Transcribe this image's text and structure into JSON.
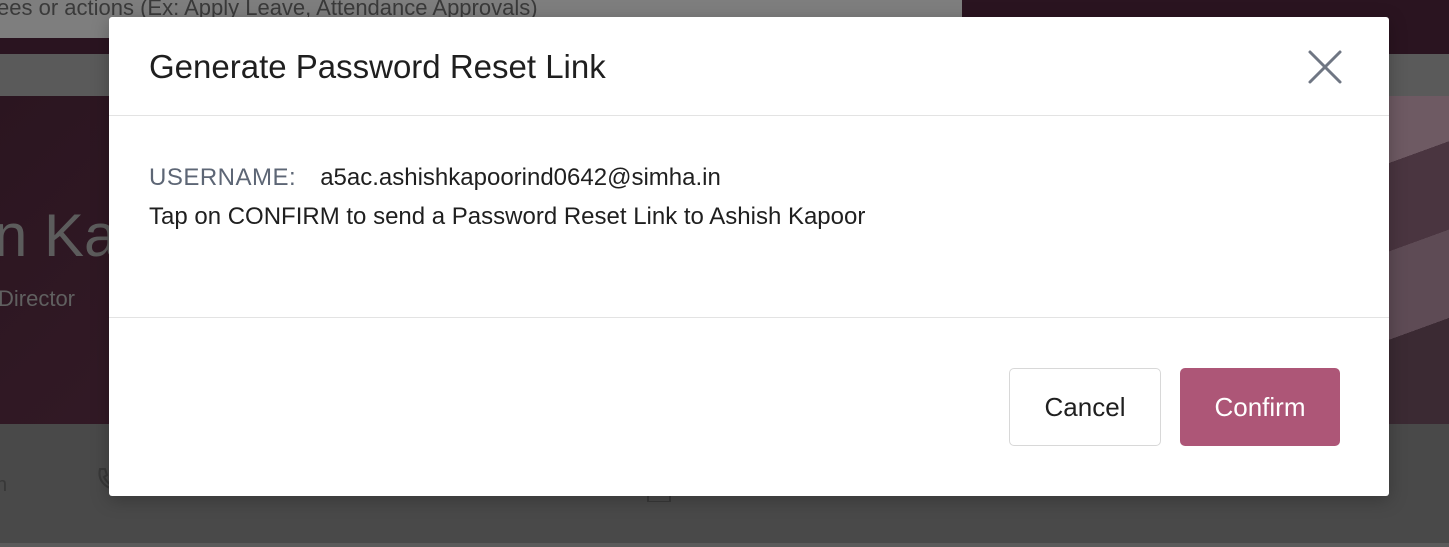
{
  "background": {
    "search_placeholder": "yees or actions (Ex: Apply Leave, Attendance Approvals)",
    "employee_name_fragment": "n Kap",
    "employee_role_fragment": "Director",
    "lower_fragment": "n"
  },
  "modal": {
    "title": "Generate Password Reset Link",
    "close_icon": "close-icon",
    "username_label": "USERNAME:",
    "username_value": "a5ac.ashishkapoorind0642@simha.in",
    "description": "Tap on CONFIRM to send a Password Reset Link to Ashish Kapoor",
    "cancel_label": "Cancel",
    "confirm_label": "Confirm"
  },
  "colors": {
    "accent": "#ad5677",
    "overlay": "#4a4a4a"
  }
}
